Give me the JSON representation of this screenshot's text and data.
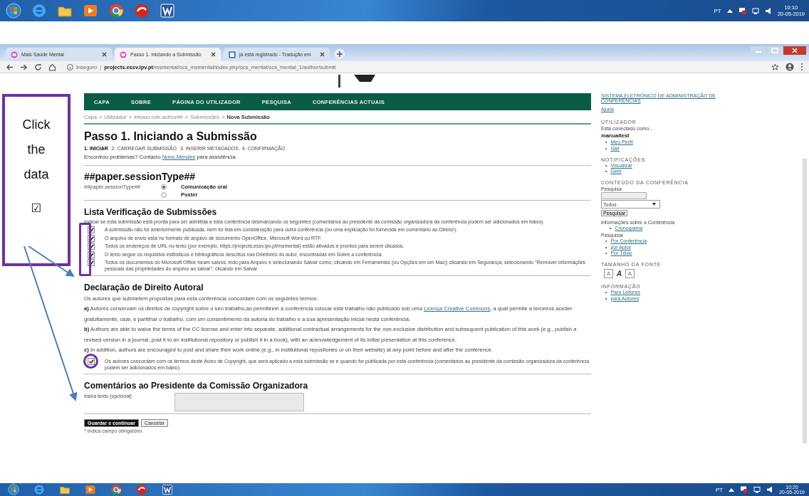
{
  "taskbar_top": {
    "language": "PT",
    "time": "10:10",
    "date": "20-05-2019"
  },
  "browser": {
    "tabs": [
      {
        "title": "Mais Saúde Mental",
        "selected": false
      },
      {
        "title": "Passo 1. Iniciando a Submissão",
        "selected": true
      },
      {
        "title": "já está registrado - Tradução em",
        "selected": false
      }
    ],
    "address": {
      "security": "Inseguro",
      "separator": "|",
      "host": "projects.essv.ipv.pt",
      "path": "/msmental/ocs_msmental/index.php/ocs_mental/ocs_mental_1/author/submit"
    }
  },
  "nav": [
    "CAPA",
    "SOBRE",
    "PÁGINA DO UTILIZADOR",
    "PESQUISA",
    "CONFERÊNCIAS ACTUAIS"
  ],
  "breadcrumb": {
    "separator": ">",
    "items": [
      {
        "label": "Capa",
        "current": false
      },
      {
        "label": "Utilizador",
        "current": false
      },
      {
        "label": "##user.role.author##",
        "current": false
      },
      {
        "label": "Submissões",
        "current": false
      },
      {
        "label": "Nova Submissão",
        "current": true
      }
    ]
  },
  "title": "Passo 1. Iniciando a Submissão",
  "steps": [
    {
      "label": "1. INICIAR",
      "selected": true
    },
    {
      "label": "2. CARREGAR SUBMISSÃO",
      "selected": false
    },
    {
      "label": "3. INSERIR METADADOS",
      "selected": false
    },
    {
      "label": "4. CONFIRMAÇÃO",
      "selected": false
    }
  ],
  "help": {
    "before": "Encontrou problemas? Contacto ",
    "link": "Nuno Mendes",
    "after": " para assistência."
  },
  "session_type": {
    "heading": "##paper.sessionType##",
    "label": "##paper.sessionType##",
    "options": [
      {
        "label": "Comunicação oral",
        "selected": true
      },
      {
        "label": "Poster",
        "selected": false
      }
    ]
  },
  "checklist": {
    "heading": "Lista Verificação de Submissões",
    "intro": "Indicar se esta submissão está pronta para ser admitida a esta conferência desmarcando os seguintes (comentários ao presidente da comissão organizadora da conferência podem ser adicionados em baixo).",
    "items": [
      {
        "text": "A submissão não foi anteriormente publicada, nem foi tida em consideração para outra conferência (ou uma explicação foi fornecida em comentário ao Diretor).",
        "checked": true
      },
      {
        "text": "O arquivo de envio está no formato de arquivo de documento OpenOffice, Microsoft Word ou RTF.",
        "checked": true
      },
      {
        "text": "Todos os endereços de URL no texto (por exemplo, https://projects.essv.ipv.pt/msmental) estão ativados e prontos para serem clicados.",
        "checked": true
      },
      {
        "text": "O texto segue os requisitos estilísticos e bibliográficos descritos nas Diretrizes do autor, encontradas em Sobre a conferência.",
        "checked": true
      },
      {
        "text": "Todos os documentos do Microsoft Office foram salvos, indo para Arquivo e selecionando Salvar como; clicando em Ferramentas (ou Opções em um Mac); clicando em Segurança; selecionando \"Remover informações pessoais das propriedades do arquivo ao salvar\"; clicando em Salvar.",
        "checked": true
      }
    ]
  },
  "copyright": {
    "heading": "Declaração de Direito Autoral",
    "intro": "Os autores que submetem propostas para esta conferência concordam com os seguintes termos:",
    "terms": [
      {
        "marker": "a)",
        "text": "Autores conservam os direitos de copyright sobre o seu trabalho,ao permitirem à conferência colocar este trabalho não publicado sob uma ",
        "link": "Licença Creative Commons",
        "text_after": ", a qual permite a terceiros aceder gratuitamente, usar, e partilhar o trabalho, com um consentimento da autoria do trabalho e a sua apresentação inicial nesta conferência."
      },
      {
        "marker": "b)",
        "text": "Authors are able to waive the terms of the CC license and enter into separate, additional contractual arrangements for the non-exclusive distribution and subsequent publication of this work (e.g., publish a revised version in a journal, post it to an institutional repository or publish it in a book), with an acknowledgement of its initial presentation at this conference."
      },
      {
        "marker": "c)",
        "text": "In addition, authors are encouraged to post and share their work online (e.g., in institutional repositories or on their website) at any point before and after the conference."
      }
    ],
    "agreement": {
      "text": "Os autores concordam com os termos deste Aviso de Copyright, que será aplicado a esta submissão se e quando for publicada por esta conferência (comentários ao presidente da comissão organizadora da conferência podem ser adicionados em baixo).",
      "checked": true
    }
  },
  "comments": {
    "heading": "Comentários ao Presidente da Comissão Organizadora",
    "label": "Insira texto (opcional)"
  },
  "buttons": [
    {
      "label": "Guardar e continuar",
      "kind": "primary"
    },
    {
      "label": "Cancelar",
      "kind": "secondary"
    }
  ],
  "footnote": "* Indica campo obrigatório",
  "sidebar": {
    "bullet": "•",
    "system_link": "SISTEMA ELETRÓNICO DE ADMINISTRAÇÃO DE CONFERÊNCIAS",
    "help_link": "Ajuda",
    "user": {
      "heading": "UTILIZADOR",
      "logged_in_as": "Está conectado como...",
      "username": "manualtest",
      "links": [
        "Meu Perfil",
        "Sair"
      ]
    },
    "notifications": {
      "heading": "NOTIFICAÇÕES",
      "links": [
        "Visualizar",
        "Gerir"
      ]
    },
    "content": {
      "heading": "CONTEÚDO DA CONFERÊNCIA",
      "search_label": "Pesquisa",
      "scope": "Todos",
      "search_button": "Pesquisar",
      "info_label": "Informações sobre a Conferência",
      "info_links": [
        "Cronograma"
      ],
      "browse_label": "Pesquisar",
      "browse_links": [
        "Por Conferência",
        "por Autor",
        "Por Título"
      ]
    },
    "font_size": {
      "heading": "TAMANHO DA FONTE",
      "buttons": [
        {
          "label": "A",
          "kind": "smaller"
        },
        {
          "label": "A",
          "kind": "normal"
        },
        {
          "label": "A",
          "kind": "larger"
        }
      ]
    },
    "information": {
      "heading": "INFORMAÇÃO",
      "links": [
        "Para Leitores",
        "para Autores"
      ]
    }
  },
  "callout": {
    "lines": [
      "Click",
      "the",
      "data"
    ],
    "symbol": "☑"
  },
  "taskbar_bottom": {
    "language": "PT",
    "time": "10:20",
    "date": "20-05-2019"
  }
}
